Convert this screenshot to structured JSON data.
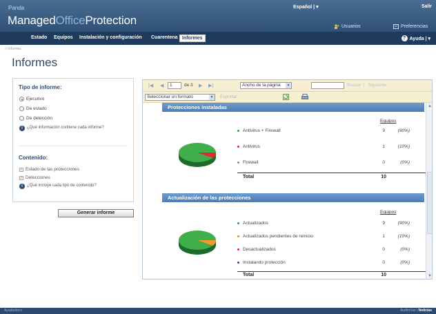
{
  "header": {
    "brand_small": "Panda",
    "brand_main_1": "Managed",
    "brand_main_2": "Office",
    "brand_main_3": "Protection",
    "language": "Español | ▾",
    "logout": "Salir",
    "users_link": "Usuarios",
    "prefs_link": "Preferencias"
  },
  "nav": {
    "items": [
      "Estado",
      "Equipos",
      "Instalación y configuración",
      "Cuarentena",
      "Informes"
    ],
    "active": "Informes",
    "help": "Ayuda | ▾"
  },
  "breadcrumb": "< Informes",
  "page_title": "Informes",
  "left_panel": {
    "report_type_heading": "Tipo de informe:",
    "report_types": [
      {
        "label": "Ejecutivo",
        "checked": true
      },
      {
        "label": "De estado",
        "checked": false
      },
      {
        "label": "De detección",
        "checked": false
      }
    ],
    "report_type_info": "¿Qué información contiene cada informe?",
    "content_heading": "Contenido:",
    "content_items": [
      "Estado de las protecciones",
      "Detecciones"
    ],
    "content_info": "¿Qué incluye cada tipo de contenido?",
    "generate_button": "Generar informe"
  },
  "viewer": {
    "toolbar": {
      "page": "1",
      "page_of": "de 3",
      "zoom": "Ancho de la página",
      "search_placeholder": "",
      "find": "Buscar",
      "next": "Siguiente",
      "format": "Seleccionar un formato",
      "export": "Exportar"
    },
    "section1": {
      "title": "Protecciones instaladas",
      "col_header": "Equipos",
      "rows": [
        {
          "label": "Antivirus + Firewall",
          "count": "9",
          "pct": "(90%)",
          "color": "#2e9b3c"
        },
        {
          "label": "Antivirus",
          "count": "1",
          "pct": "(10%)",
          "color": "#d9262c"
        },
        {
          "label": "Firewall",
          "count": "0",
          "pct": "(0%)",
          "color": "#7a8fa6"
        }
      ],
      "total_label": "Total",
      "total_count": "10"
    },
    "section2": {
      "title": "Actualización de las protecciones",
      "col_header": "Equipos",
      "rows": [
        {
          "label": "Actualizados",
          "count": "9",
          "pct": "(90%)",
          "color": "#2e9b3c"
        },
        {
          "label": "Actualizados pendientes de reinicio",
          "count": "1",
          "pct": "(10%)",
          "color": "#f08a1c"
        },
        {
          "label": "Desactualizados",
          "count": "0",
          "pct": "(0%)",
          "color": "#d9262c"
        },
        {
          "label": "Instalando protección",
          "count": "0",
          "pct": "(0%)",
          "color": "#2e3f9e"
        }
      ],
      "total_label": "Total",
      "total_count": "10"
    }
  },
  "footer": {
    "left": "Ayuda/docs",
    "right_1": "Auditorías",
    "right_2": "Noticias"
  },
  "colors": {
    "header": "#2f5177",
    "navbar": "#1e3a5c",
    "section_bar": "#4c7bb3",
    "pie_green": "#2e9b3c",
    "pie_red": "#d9262c",
    "pie_orange": "#f08a1c"
  }
}
